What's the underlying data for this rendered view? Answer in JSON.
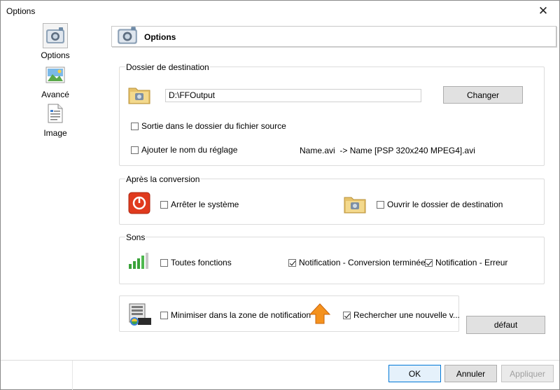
{
  "window": {
    "title": "Options",
    "close_glyph": "✕"
  },
  "nav": {
    "items": [
      {
        "label": "Options",
        "icon": "options-icon",
        "selected": true
      },
      {
        "label": "Avancé",
        "icon": "advanced-icon",
        "selected": false
      },
      {
        "label": "Image",
        "icon": "image-icon",
        "selected": false
      }
    ]
  },
  "header": {
    "title": "Options",
    "icon": "options-icon"
  },
  "destination": {
    "title": "Dossier de destination",
    "path": "D:\\FFOutput",
    "change_label": "Changer",
    "output_in_source_label": "Sortie dans le dossier du fichier source",
    "output_in_source_checked": false,
    "add_preset_name_label": "Ajouter le nom du réglage",
    "add_preset_name_checked": false,
    "example_text": "Name.avi  -> Name [PSP 320x240 MPEG4].avi"
  },
  "after": {
    "title": "Après la conversion",
    "shutdown_label": "Arrêter le système",
    "shutdown_checked": false,
    "open_folder_label": "Ouvrir le dossier de destination",
    "open_folder_checked": false
  },
  "sounds": {
    "title": "Sons",
    "all_label": "Toutes fonctions",
    "all_checked": false,
    "done_label": "Notification - Conversion terminée",
    "done_checked": true,
    "error_label": "Notification - Erreur",
    "error_checked": true
  },
  "misc": {
    "minimize_label": "Minimiser dans la zone de notification",
    "minimize_checked": false,
    "update_label": "Rechercher une nouvelle v...",
    "update_checked": true
  },
  "buttons": {
    "default_label": "défaut",
    "ok_label": "OK",
    "cancel_label": "Annuler",
    "apply_label": "Appliquer"
  },
  "colors": {
    "accent": "#0078d7",
    "shutdown_red": "#e03a1e",
    "update_orange": "#f5921e",
    "signal_green": "#3aa33a"
  }
}
